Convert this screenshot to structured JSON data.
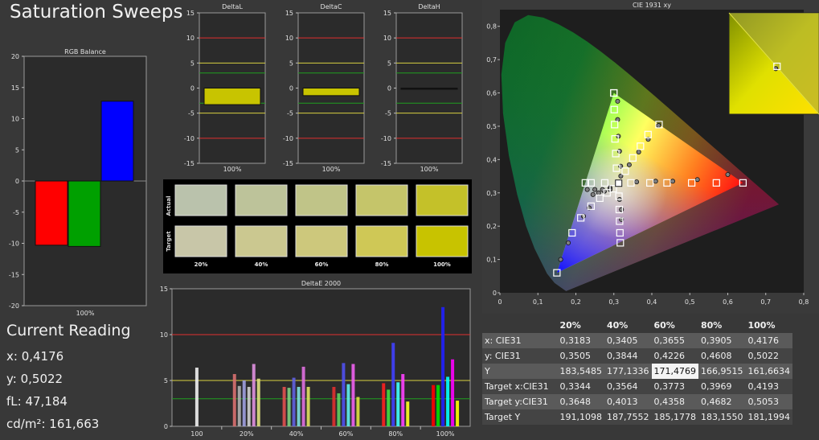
{
  "title": "Saturation Sweeps",
  "current_reading": {
    "heading": "Current Reading",
    "lines": [
      "x: 0,4176",
      "y: 0,5022",
      "fL: 47,184",
      "cd/m²: 161,663"
    ]
  },
  "chart_data": [
    {
      "id": "rgb",
      "type": "bar",
      "title": "RGB Balance",
      "categories": [
        "100%"
      ],
      "series": [
        {
          "color": "#ff0000",
          "values": [
            -10.3
          ]
        },
        {
          "color": "#00a000",
          "values": [
            -10.5
          ]
        },
        {
          "color": "#0000ff",
          "values": [
            12.8
          ]
        }
      ],
      "ylim": [
        -20,
        20
      ],
      "yticks": [
        "20",
        "15",
        "10",
        "5",
        "0",
        "-5",
        "-10",
        "-15",
        "-20"
      ]
    },
    {
      "id": "dl",
      "type": "bar",
      "title": "DeltaL",
      "categories": [
        "100%"
      ],
      "values": [
        -3.3
      ],
      "ylim": [
        -15,
        15
      ],
      "yticks": [
        "15",
        "10",
        "5",
        "0",
        "-5",
        "-10",
        "-15"
      ]
    },
    {
      "id": "dc",
      "type": "bar",
      "title": "DeltaC",
      "categories": [
        "100%"
      ],
      "values": [
        -1.5
      ],
      "ylim": [
        -15,
        15
      ],
      "yticks": [
        "15",
        "10",
        "5",
        "0",
        "-5",
        "-10",
        "-15"
      ]
    },
    {
      "id": "dh",
      "type": "bar",
      "title": "DeltaH",
      "categories": [
        "100%"
      ],
      "values": [
        -0.1
      ],
      "ylim": [
        -15,
        15
      ],
      "yticks": [
        "15",
        "10",
        "5",
        "0",
        "-5",
        "-10",
        "-15"
      ]
    },
    {
      "id": "de",
      "type": "bar",
      "title": "DeltaE 2000",
      "categories": [
        "100",
        "20%",
        "40%",
        "60%",
        "80%",
        "100%"
      ],
      "ylim": [
        0,
        15
      ],
      "yticks": [
        "15",
        "10",
        "5",
        "0"
      ],
      "group_values": [
        [
          6.4
        ],
        [
          5.7,
          4.4,
          5.0,
          4.3,
          6.8,
          5.2
        ],
        [
          4.3,
          4.2,
          5.3,
          4.3,
          6.5,
          4.3
        ],
        [
          4.3,
          3.6,
          6.9,
          4.6,
          6.8,
          3.2
        ],
        [
          4.7,
          4.0,
          9.1,
          4.8,
          5.7,
          2.7
        ],
        [
          4.5,
          4.5,
          13.0,
          5.4,
          7.3,
          2.8
        ]
      ],
      "group_colors": [
        [
          "#f0f0f0"
        ],
        [
          "#d87070",
          "#b0b0b0",
          "#a0a0e0",
          "#d0d0d0",
          "#e090e0",
          "#e0e080"
        ],
        [
          "#e05050",
          "#80d080",
          "#6060e0",
          "#80e0e0",
          "#e070e0",
          "#e0e060"
        ],
        [
          "#e03030",
          "#60d060",
          "#5050f0",
          "#60f0f0",
          "#f060f0",
          "#e0e040"
        ],
        [
          "#ff2020",
          "#40e040",
          "#4040ff",
          "#40ffff",
          "#ff40ff",
          "#ffff20"
        ],
        [
          "#ff0000",
          "#00e000",
          "#2020ff",
          "#00ffff",
          "#ff00ff",
          "#ffff00"
        ]
      ]
    },
    {
      "id": "cie",
      "type": "scatter",
      "title": "CIE 1931 xy",
      "xlim": [
        0,
        0.8
      ],
      "ylim": [
        0,
        0.85
      ],
      "xticks": [
        "0",
        "0,1",
        "0,2",
        "0,3",
        "0,4",
        "0,5",
        "0,6",
        "0,7",
        "0,8"
      ],
      "yticks": [
        "0,8",
        "0,7",
        "0,6",
        "0,5",
        "0,4",
        "0,3",
        "0,2",
        "0,1",
        "0"
      ],
      "gamut": [
        [
          0.64,
          0.33
        ],
        [
          0.3,
          0.6
        ],
        [
          0.15,
          0.06
        ]
      ],
      "white_point": [
        0.3127,
        0.329
      ],
      "target_points": [
        [
          0.3127,
          0.329
        ],
        [
          0.345,
          0.33
        ],
        [
          0.395,
          0.33
        ],
        [
          0.44,
          0.33
        ],
        [
          0.505,
          0.33
        ],
        [
          0.57,
          0.33
        ],
        [
          0.64,
          0.33
        ],
        [
          0.307,
          0.374
        ],
        [
          0.305,
          0.418
        ],
        [
          0.303,
          0.462
        ],
        [
          0.302,
          0.505
        ],
        [
          0.301,
          0.55
        ],
        [
          0.3,
          0.6
        ],
        [
          0.2985,
          0.3125
        ],
        [
          0.282,
          0.3
        ],
        [
          0.263,
          0.284
        ],
        [
          0.24,
          0.26
        ],
        [
          0.213,
          0.225
        ],
        [
          0.19,
          0.18
        ],
        [
          0.15,
          0.06
        ],
        [
          0.3134,
          0.29
        ],
        [
          0.3142,
          0.25
        ],
        [
          0.3151,
          0.215
        ],
        [
          0.316,
          0.18
        ],
        [
          0.317,
          0.15
        ],
        [
          0.276,
          0.33
        ],
        [
          0.24,
          0.33
        ],
        [
          0.225,
          0.33
        ],
        [
          0.33,
          0.365
        ],
        [
          0.35,
          0.405
        ],
        [
          0.37,
          0.44
        ],
        [
          0.39,
          0.475
        ],
        [
          0.419,
          0.505
        ],
        [
          0.3,
          0.6
        ]
      ],
      "measured_points": [
        [
          0.3183,
          0.3505
        ],
        [
          0.3405,
          0.3844
        ],
        [
          0.3655,
          0.4226
        ],
        [
          0.3905,
          0.4608
        ],
        [
          0.4176,
          0.5022
        ],
        [
          0.36,
          0.333
        ],
        [
          0.41,
          0.335
        ],
        [
          0.455,
          0.335
        ],
        [
          0.52,
          0.34
        ],
        [
          0.6,
          0.355
        ],
        [
          0.318,
          0.38
        ],
        [
          0.315,
          0.425
        ],
        [
          0.312,
          0.47
        ],
        [
          0.31,
          0.52
        ],
        [
          0.31,
          0.575
        ],
        [
          0.29,
          0.315
        ],
        [
          0.275,
          0.305
        ],
        [
          0.26,
          0.3
        ],
        [
          0.245,
          0.295
        ],
        [
          0.235,
          0.255
        ],
        [
          0.22,
          0.23
        ],
        [
          0.18,
          0.15
        ],
        [
          0.16,
          0.1
        ],
        [
          0.315,
          0.28
        ],
        [
          0.32,
          0.25
        ],
        [
          0.32,
          0.22
        ],
        [
          0.29,
          0.31
        ],
        [
          0.27,
          0.31
        ],
        [
          0.25,
          0.31
        ],
        [
          0.23,
          0.31
        ]
      ],
      "inset_points": {
        "target": [
          0.4193,
          0.5053
        ],
        "measured": [
          0.4176,
          0.5022
        ]
      }
    }
  ],
  "swatches": {
    "row_labels": [
      "Actual",
      "Target"
    ],
    "columns": [
      "20%",
      "40%",
      "60%",
      "80%",
      "100%"
    ],
    "actual_colors": [
      "#bac2ac",
      "#bdc39a",
      "#c0c488",
      "#c5c56a",
      "#c4c129"
    ],
    "target_colors": [
      "#c8c6a8",
      "#cbc890",
      "#cdc87c",
      "#cfc856",
      "#c8c300"
    ]
  },
  "table": {
    "columns": [
      "",
      "20%",
      "40%",
      "60%",
      "80%",
      "100%"
    ],
    "rows": [
      {
        "label": "x: CIE31",
        "values": [
          "0,3183",
          "0,3405",
          "0,3655",
          "0,3905",
          "0,4176"
        ]
      },
      {
        "label": "y: CIE31",
        "values": [
          "0,3505",
          "0,3844",
          "0,4226",
          "0,4608",
          "0,5022"
        ]
      },
      {
        "label": "Y",
        "values": [
          "183,5485",
          "177,1336",
          "171,4769",
          "166,9515",
          "161,6634"
        ],
        "highlight": 2
      },
      {
        "label": "Target x:CIE31",
        "values": [
          "0,3344",
          "0,3564",
          "0,3773",
          "0,3969",
          "0,4193"
        ]
      },
      {
        "label": "Target y:CIE31",
        "values": [
          "0,3648",
          "0,4013",
          "0,4358",
          "0,4682",
          "0,5053"
        ]
      },
      {
        "label": "Target Y",
        "values": [
          "191,1098",
          "187,7552",
          "185,1778",
          "183,1550",
          "181,1994"
        ]
      }
    ]
  }
}
